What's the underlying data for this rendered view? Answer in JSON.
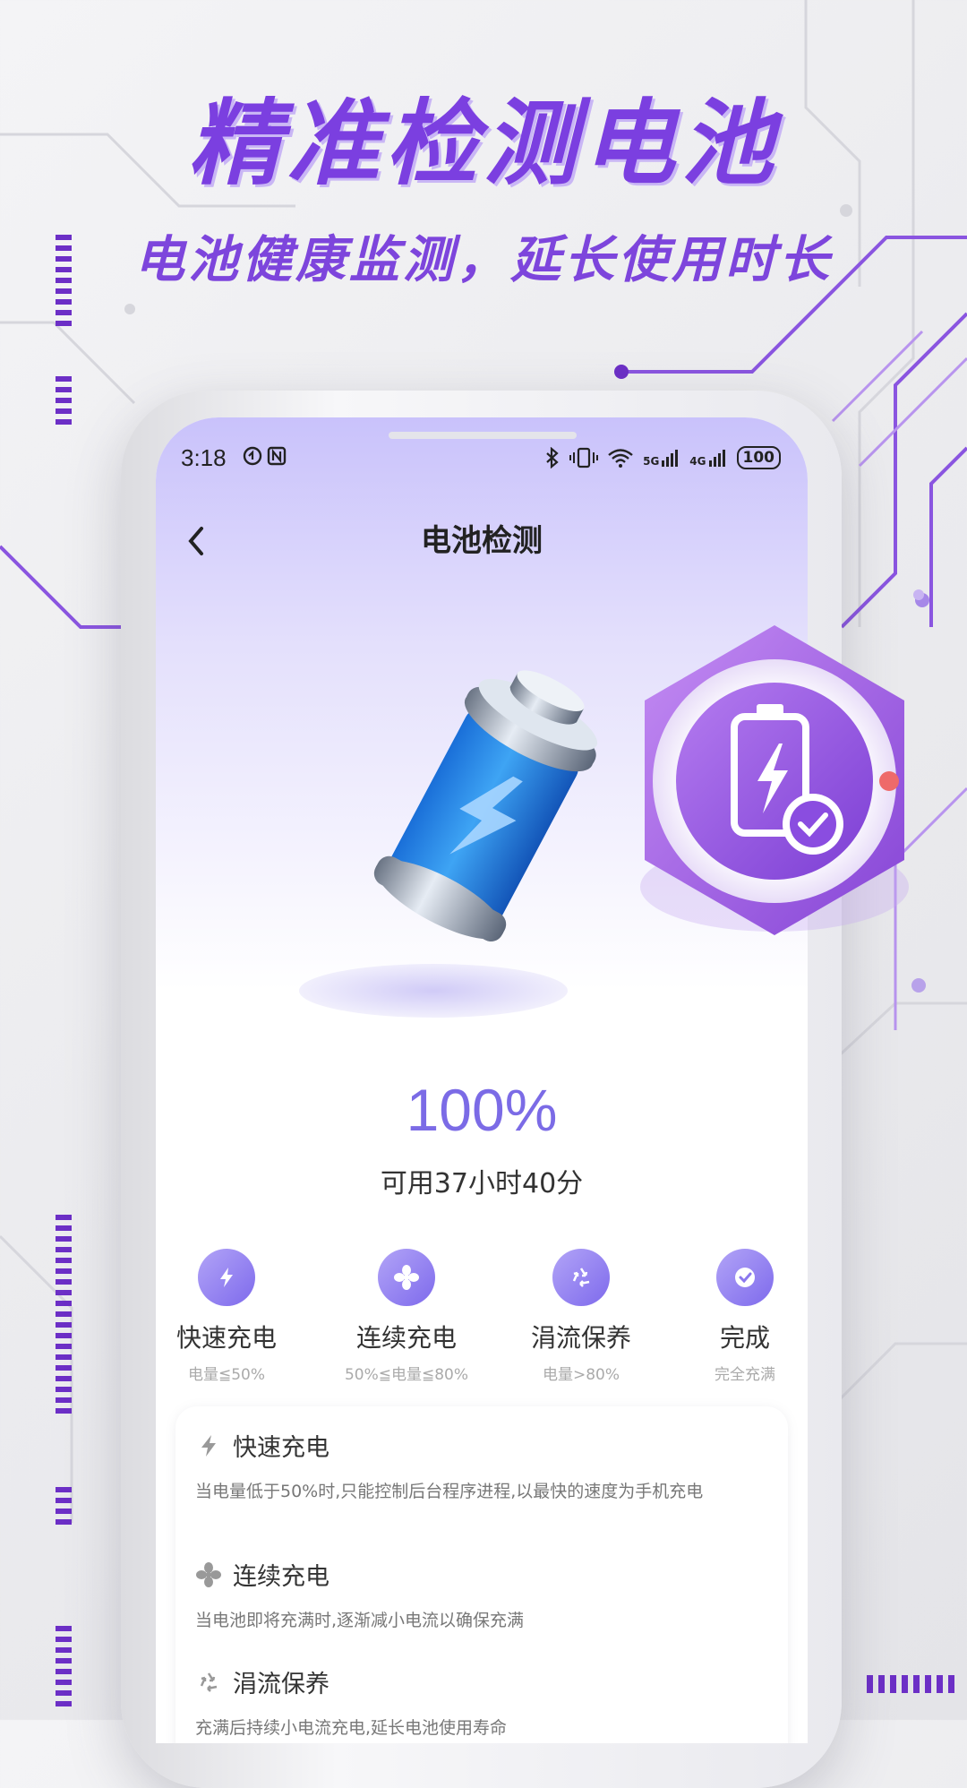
{
  "promo": {
    "headline": "精准检测电池",
    "subheadline": "电池健康监测，延长使用时长"
  },
  "status_bar": {
    "time": "3:18",
    "battery": "100",
    "network_5g": "5G",
    "network_4g": "4G"
  },
  "nav": {
    "back_icon": "chevron-left-icon",
    "title": "电池检测"
  },
  "battery": {
    "percent_text": "100%",
    "percent": 100,
    "remaining": "可用37小时40分"
  },
  "steps": [
    {
      "icon": "lightning-icon",
      "label": "快速充电",
      "sub": "电量≦50%"
    },
    {
      "icon": "fan-icon",
      "label": "连续充电",
      "sub": "50%≦电量≦80%"
    },
    {
      "icon": "recycle-icon",
      "label": "涓流保养",
      "sub": "电量>80%"
    },
    {
      "icon": "check-icon",
      "label": "完成",
      "sub": "完全充满"
    }
  ],
  "details": [
    {
      "icon": "lightning-icon",
      "title": "快速充电",
      "desc": "当电量低于50%时,只能控制后台程序进程,以最快的速度为手机充电"
    },
    {
      "icon": "fan-icon",
      "title": "连续充电",
      "desc": "当电池即将充满时,逐渐减小电流以确保充满"
    },
    {
      "icon": "recycle-icon",
      "title": "涓流保养",
      "desc": "充满后持续小电流充电,延长电池使用寿命"
    }
  ],
  "colors": {
    "accent": "#7b6be6",
    "promo_purple": "#7b3fe0"
  }
}
